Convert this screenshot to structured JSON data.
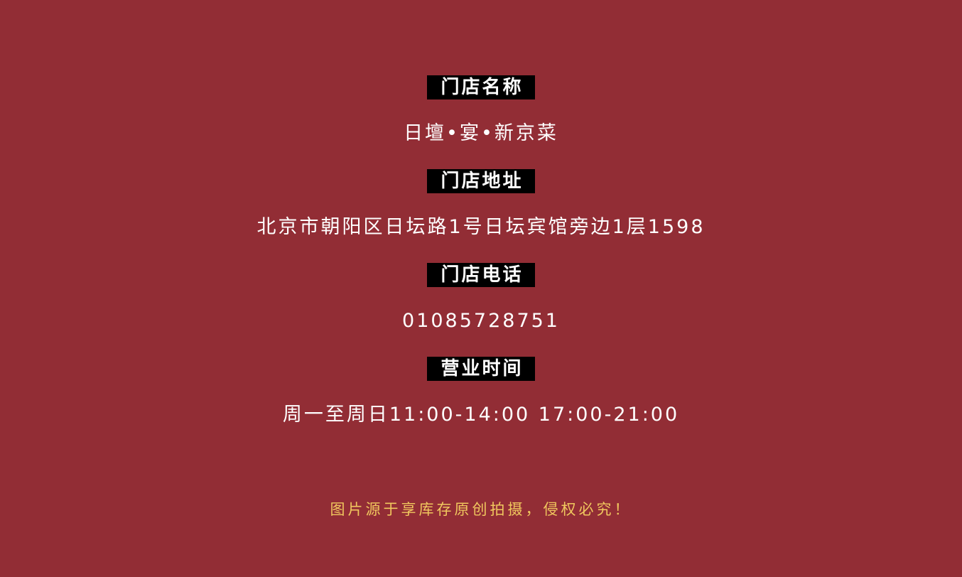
{
  "colors": {
    "background": "#922d35",
    "label_background": "#000000",
    "label_text": "#ffffff",
    "value_text": "#ffffff",
    "footer_text": "#f0c75e"
  },
  "store": {
    "name_label": "门店名称",
    "name_value": "日壇•宴•新京菜",
    "address_label": "门店地址",
    "address_value": "北京市朝阳区日坛路1号日坛宾馆旁边1层1598",
    "phone_label": "门店电话",
    "phone_value": "01085728751",
    "hours_label": "营业时间",
    "hours_value": "周一至周日11:00-14:00 17:00-21:00"
  },
  "footer": {
    "notice": "图片源于享库存原创拍摄，侵权必究！"
  }
}
